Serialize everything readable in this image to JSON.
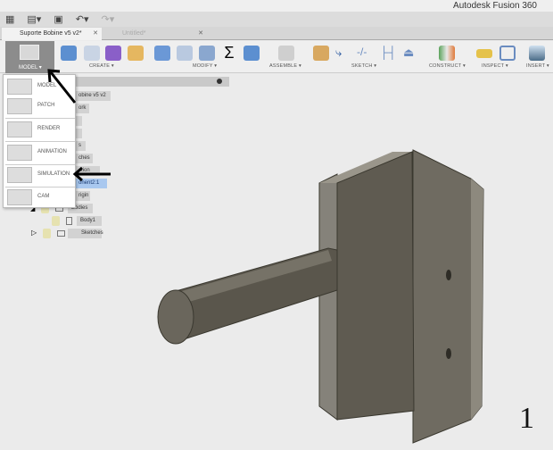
{
  "app": {
    "title": "Autodesk Fusion 360"
  },
  "quickbar": {
    "icons": [
      "grid-icon",
      "file-icon",
      "save-icon",
      "undo-icon",
      "redo-icon"
    ]
  },
  "tabs": [
    {
      "label": "Suporte Bobine v5 v2*",
      "active": true
    },
    {
      "label": "Untitled*",
      "active": false
    }
  ],
  "ribbon": {
    "model_label": "MODEL ▾",
    "groups": [
      "CREATE ▾",
      "MODIFY ▾",
      "ASSEMBLE ▾",
      "SKETCH ▾",
      "CONSTRUCT ▾",
      "INSPECT ▾",
      "INSERT ▾"
    ]
  },
  "workspace_menu": [
    {
      "label": "MODEL"
    },
    {
      "label": "PATCH"
    },
    {
      "label": "RENDER"
    },
    {
      "label": "ANIMATION"
    },
    {
      "label": "SIMULATION"
    },
    {
      "label": "CAM"
    }
  ],
  "browser": {
    "rows": [
      "obine v5 v2",
      "ork",
      "",
      "",
      "s",
      "ches",
      "ction",
      "onent2:1",
      "rigin",
      "Bodies",
      "Body1",
      "Sketches"
    ],
    "selected": "onent2:1"
  },
  "annotation": {
    "step": "1"
  }
}
